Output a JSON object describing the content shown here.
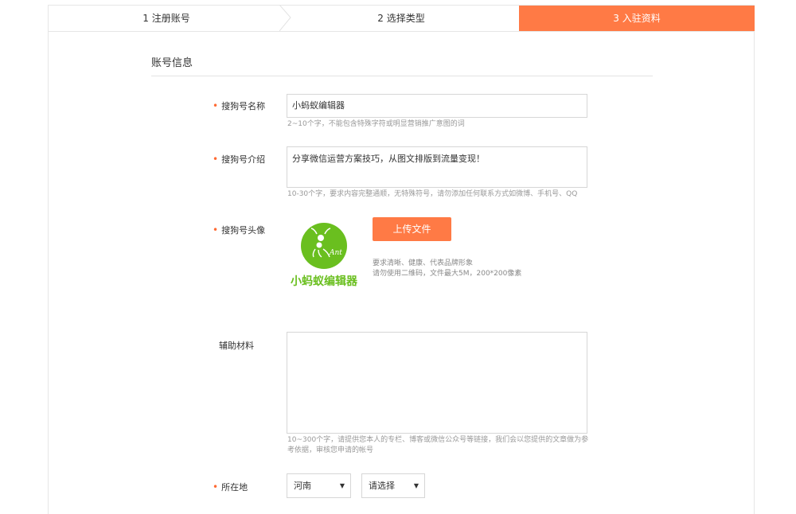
{
  "steps": [
    {
      "label": "1 注册账号",
      "active": false
    },
    {
      "label": "2 选择类型",
      "active": false
    },
    {
      "label": "3 入驻资料",
      "active": true
    }
  ],
  "colors": {
    "accent": "#ff7a45",
    "required_dot": "#ff6a33",
    "logo_green": "#6abf1f"
  },
  "section": {
    "title": "账号信息"
  },
  "required_mark": "•",
  "fields": {
    "name": {
      "label": "搜狗号名称",
      "value": "小蚂蚁编辑器",
      "hint": "2~10个字，不能包含特殊字符或明显营销推广意图的词"
    },
    "intro": {
      "label": "搜狗号介绍",
      "value": "分享微信运营方案技巧，从图文排版到流量变现！",
      "hint": "10-30个字，要求内容完整通顺，无特殊符号，请勿添加任何联系方式如微博、手机号、QQ"
    },
    "avatar": {
      "label": "搜狗号头像",
      "upload_label": "上传文件",
      "hint_line1": "要求清晰、健康、代表品牌形象",
      "hint_line2": "请勿使用二维码，文件最大5M，200*200像素",
      "logo_text": "小蚂蚁编辑器",
      "logo_script": "Ant"
    },
    "materials": {
      "label": "辅助材料",
      "value": "",
      "hint": "10~300个字，请提供您本人的专栏、博客或微信公众号等链接，我们会以您提供的文章做为参考依据，审核您申请的帐号"
    },
    "location": {
      "label": "所在地",
      "province": "河南",
      "city": "请选择"
    }
  }
}
